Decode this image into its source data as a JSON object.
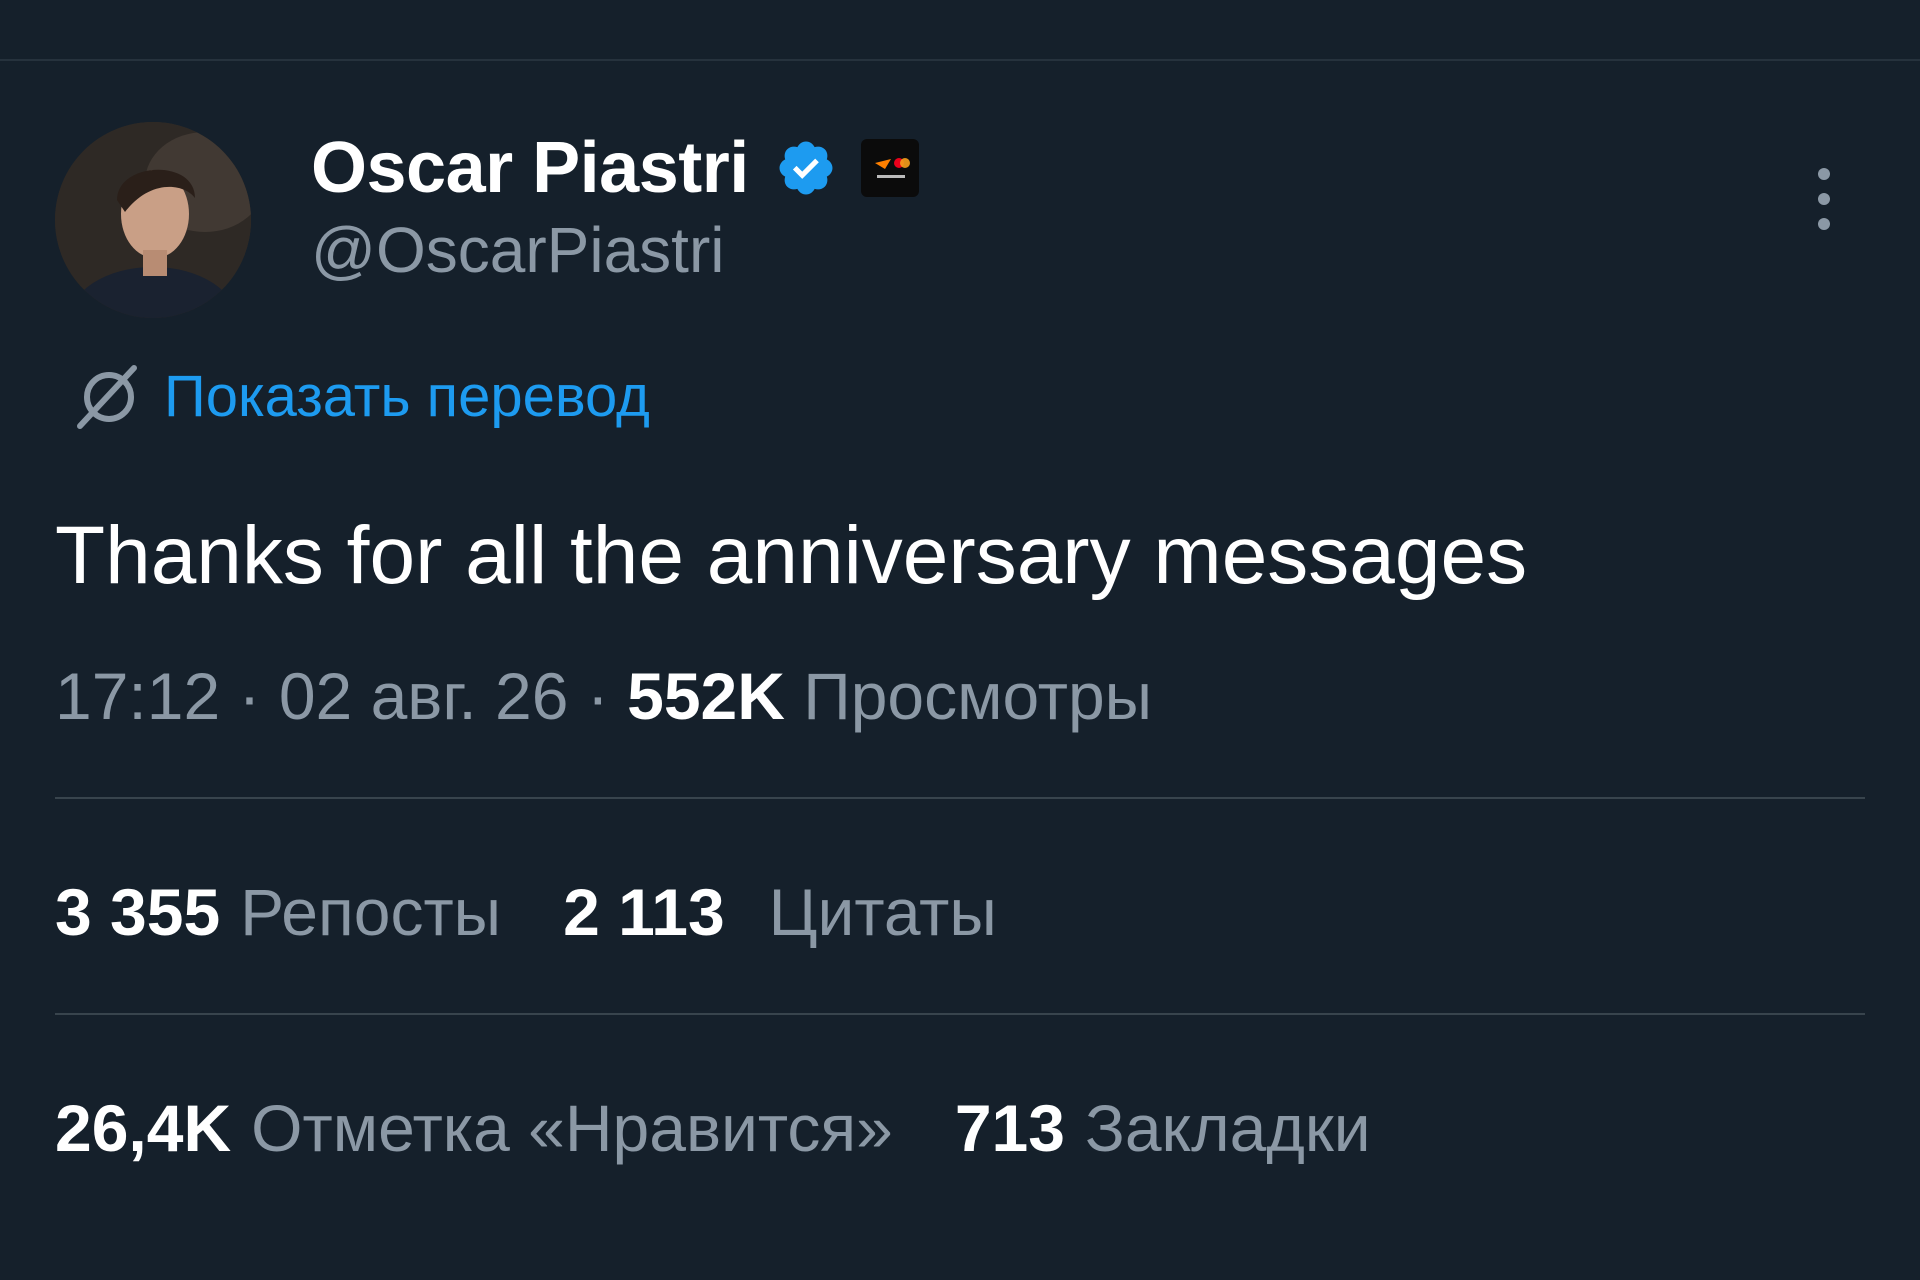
{
  "tweet": {
    "author": {
      "name": "Oscar Piastri",
      "handle": "@OscarPiastri",
      "verified": true,
      "avatar_icon": "avatar-photo",
      "affiliate_badge_icon": "team-badge-icon"
    },
    "translate_label": "Показать перевод",
    "text": "Thanks for all the anniversary messages",
    "time": "17:12",
    "separator": "·",
    "date": "02 авг. 26",
    "views_count": "552K",
    "views_label": "Просмотры"
  },
  "stats": {
    "reposts": {
      "count": "3 355",
      "label": "Репосты"
    },
    "quotes": {
      "count": "2 113",
      "label": "Цитаты"
    },
    "likes": {
      "count": "26,4K",
      "label": "Отметка «Нравится»"
    },
    "bookmarks": {
      "count": "713",
      "label": "Закладки"
    }
  },
  "colors": {
    "background": "#15202b",
    "accent": "#1d9bf0",
    "muted_text": "#8b98a5",
    "divider": "#38444d"
  }
}
